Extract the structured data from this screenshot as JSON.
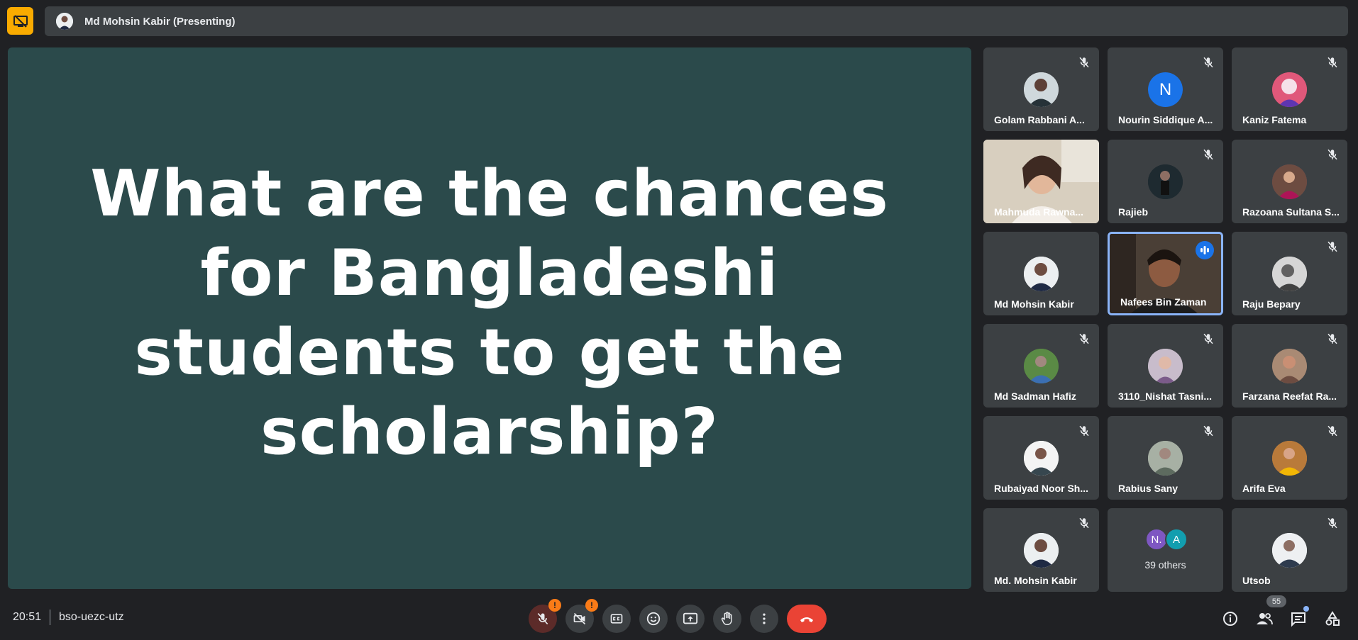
{
  "header": {
    "presenter_label": "Md Mohsin Kabir (Presenting)"
  },
  "slide": {
    "text": "What are the chances for Bangladeshi students to get the scholarship?"
  },
  "participants": [
    {
      "name": "Golam Rabbani A...",
      "muted": true,
      "avatar": "photo",
      "color": "#d7d3cf"
    },
    {
      "name": "Nourin Siddique A...",
      "muted": true,
      "avatar": "N",
      "color": "#1a73e8"
    },
    {
      "name": "Kaniz Fatema",
      "muted": true,
      "avatar": "photo",
      "color": "#c84a6a"
    },
    {
      "name": "Mahmuda Rawna...",
      "muted": false,
      "avatar": "video",
      "color": "#d6cbbb"
    },
    {
      "name": "Rajieb",
      "muted": true,
      "avatar": "photo",
      "color": "#1e2a30"
    },
    {
      "name": "Razoana Sultana S...",
      "muted": true,
      "avatar": "photo",
      "color": "#7b4d63"
    },
    {
      "name": "Md Mohsin Kabir",
      "muted": false,
      "avatar": "photo",
      "color": "#e8e6e3"
    },
    {
      "name": "Nafees Bin Zaman",
      "muted": false,
      "avatar": "video",
      "color": "#3a302a",
      "speaking": true
    },
    {
      "name": "Raju Bepary",
      "muted": true,
      "avatar": "photo",
      "color": "#bdbdbd"
    },
    {
      "name": "Md Sadman Hafiz",
      "muted": true,
      "avatar": "photo",
      "color": "#4e7a3a"
    },
    {
      "name": "3110_Nishat Tasni...",
      "muted": true,
      "avatar": "photo",
      "color": "#b9aab8"
    },
    {
      "name": "Farzana Reefat Ra...",
      "muted": true,
      "avatar": "photo",
      "color": "#8a6a58"
    },
    {
      "name": "Rubaiyad Noor Sh...",
      "muted": true,
      "avatar": "photo",
      "color": "#f1f1f1"
    },
    {
      "name": "Rabius Sany",
      "muted": true,
      "avatar": "photo",
      "color": "#9aa59b"
    },
    {
      "name": "Arifa Eva",
      "muted": true,
      "avatar": "photo",
      "color": "#c78e4a"
    },
    {
      "name": "Md. Mohsin Kabir",
      "muted": true,
      "avatar": "photo",
      "color": "#e8e6e3"
    },
    {
      "name": "39 others",
      "muted": false,
      "avatar": "others",
      "color": "#3c4043"
    },
    {
      "name": "Utsob",
      "muted": true,
      "avatar": "photo",
      "color": "#e6e8ea"
    }
  ],
  "others": {
    "initials": [
      "N.",
      "A"
    ],
    "colors": [
      "#7e57c2",
      "#129eaf"
    ],
    "label": "39 others"
  },
  "footer": {
    "time": "20:51",
    "meeting_code": "bso-uezc-utz",
    "participant_count": "55",
    "warning": "!"
  },
  "colors": {
    "leave": "#ea4335",
    "accent": "#8ab4f8",
    "present_badge": "#f9ab00",
    "slide_bg": "#2b4a4b"
  },
  "icons": [
    "present-off-icon",
    "mic-off-icon",
    "camera-off-icon",
    "captions-icon",
    "emoji-icon",
    "present-icon",
    "hand-icon",
    "more-icon",
    "leave-call-icon",
    "info-icon",
    "people-icon",
    "chat-icon",
    "activities-icon"
  ]
}
